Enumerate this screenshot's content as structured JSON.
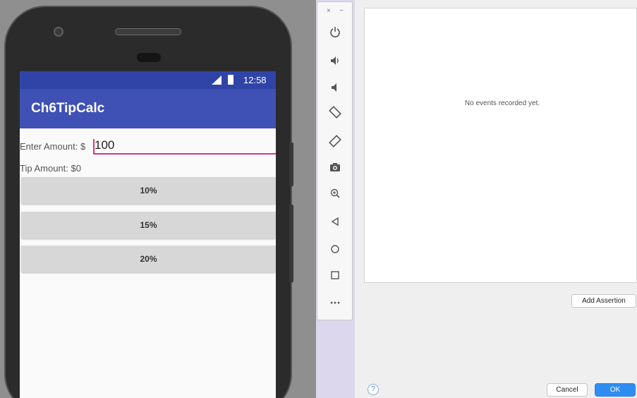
{
  "app": {
    "status_time": "12:58",
    "title": "Ch6TipCalc",
    "amount_label": "Enter Amount: $",
    "amount_value": "100",
    "tip_label": "Tip Amount: $0",
    "buttons": [
      "10%",
      "15%",
      "20%"
    ]
  },
  "toolbar": {
    "close_label": "×",
    "minimize_label": "−",
    "icons": [
      "power-icon",
      "volume-up-icon",
      "volume-down-icon",
      "rotate-left-icon",
      "rotate-right-icon",
      "camera-icon",
      "zoom-icon",
      "back-icon",
      "home-icon",
      "overview-icon",
      "more-icon"
    ]
  },
  "recorder": {
    "empty_message": "No events recorded yet.",
    "add_assertion_label": "Add Assertion",
    "help_label": "?",
    "cancel_label": "Cancel",
    "ok_label": "OK"
  },
  "colors": {
    "app_bar": "#3f51b5",
    "status_bar": "#3044a8",
    "input_accent": "#d63a8a",
    "ok_button": "#2f8df2"
  }
}
